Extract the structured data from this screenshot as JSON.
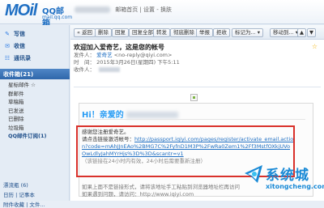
{
  "header": {
    "logo_main": "MOil",
    "logo_qq": "QQ邮箱",
    "logo_domain": "mail.qq.com",
    "user_links": "邮箱首页 | 设置 - 换肤"
  },
  "sidebar": {
    "write": "写信",
    "inbox": "收信",
    "contacts": "通讯录",
    "folder_header": "收件箱(21)",
    "folders": [
      "星标邮件 ☆",
      "群邮件",
      "草稿箱",
      "已发送",
      "已删除",
      "垃圾箱",
      "QQ邮件订阅(1)"
    ],
    "bottom1": "漂流瓶 (6)",
    "bottom2": "日历 | 记事本",
    "bottom3": "附件收藏 | 文件..."
  },
  "toolbar": {
    "back": "« 返回",
    "delete": "删除",
    "reply": "回复",
    "reply_all": "回复全部",
    "forward": "转发",
    "perm_delete": "彻底删除",
    "report": "举报",
    "reject": "拒收",
    "mark_as": "标记为... ▾",
    "move_to": "移动到... ▾",
    "prev": "▲",
    "next": "▼"
  },
  "message": {
    "subject": "欢迎加入爱奇艺，这是您的帐号",
    "from_label": "发件人：",
    "from_name": "爱奇艺",
    "from_addr": "<no-reply@qiyi.com>",
    "time_label": "时　间：",
    "time_value": "2015年3月26日(星期四) 下午5:11",
    "to_label": "收件人："
  },
  "email": {
    "greeting": "Hi！亲爱的",
    "thanks": "感谢您注册爱奇艺。",
    "link_prefix": "请点击链接激活帐号：",
    "link_text": "http://passport.iqiyi.com/pages/register/activate_email.action?code=mAhJJnEAo%2BMG7C%2FyfnD1M3P%2FwRa0Zem1%2Ff3MstfOXkjUVo",
    "link_tail": "OwLdlyJahMYrHjs%3D%3D&scantr=v1",
    "note": "（该链接在24小时内有效，24小时后需要重新注册）",
    "footer1": "如果上面不是链接形式，请将该地址手工粘贴到浏览器地址栏再访问",
    "footer2": "如果遇到问题，请访问：http://www.iqiyi.com"
  },
  "watermark": {
    "brand": "系统城",
    "url": "xitongcheng.com"
  }
}
